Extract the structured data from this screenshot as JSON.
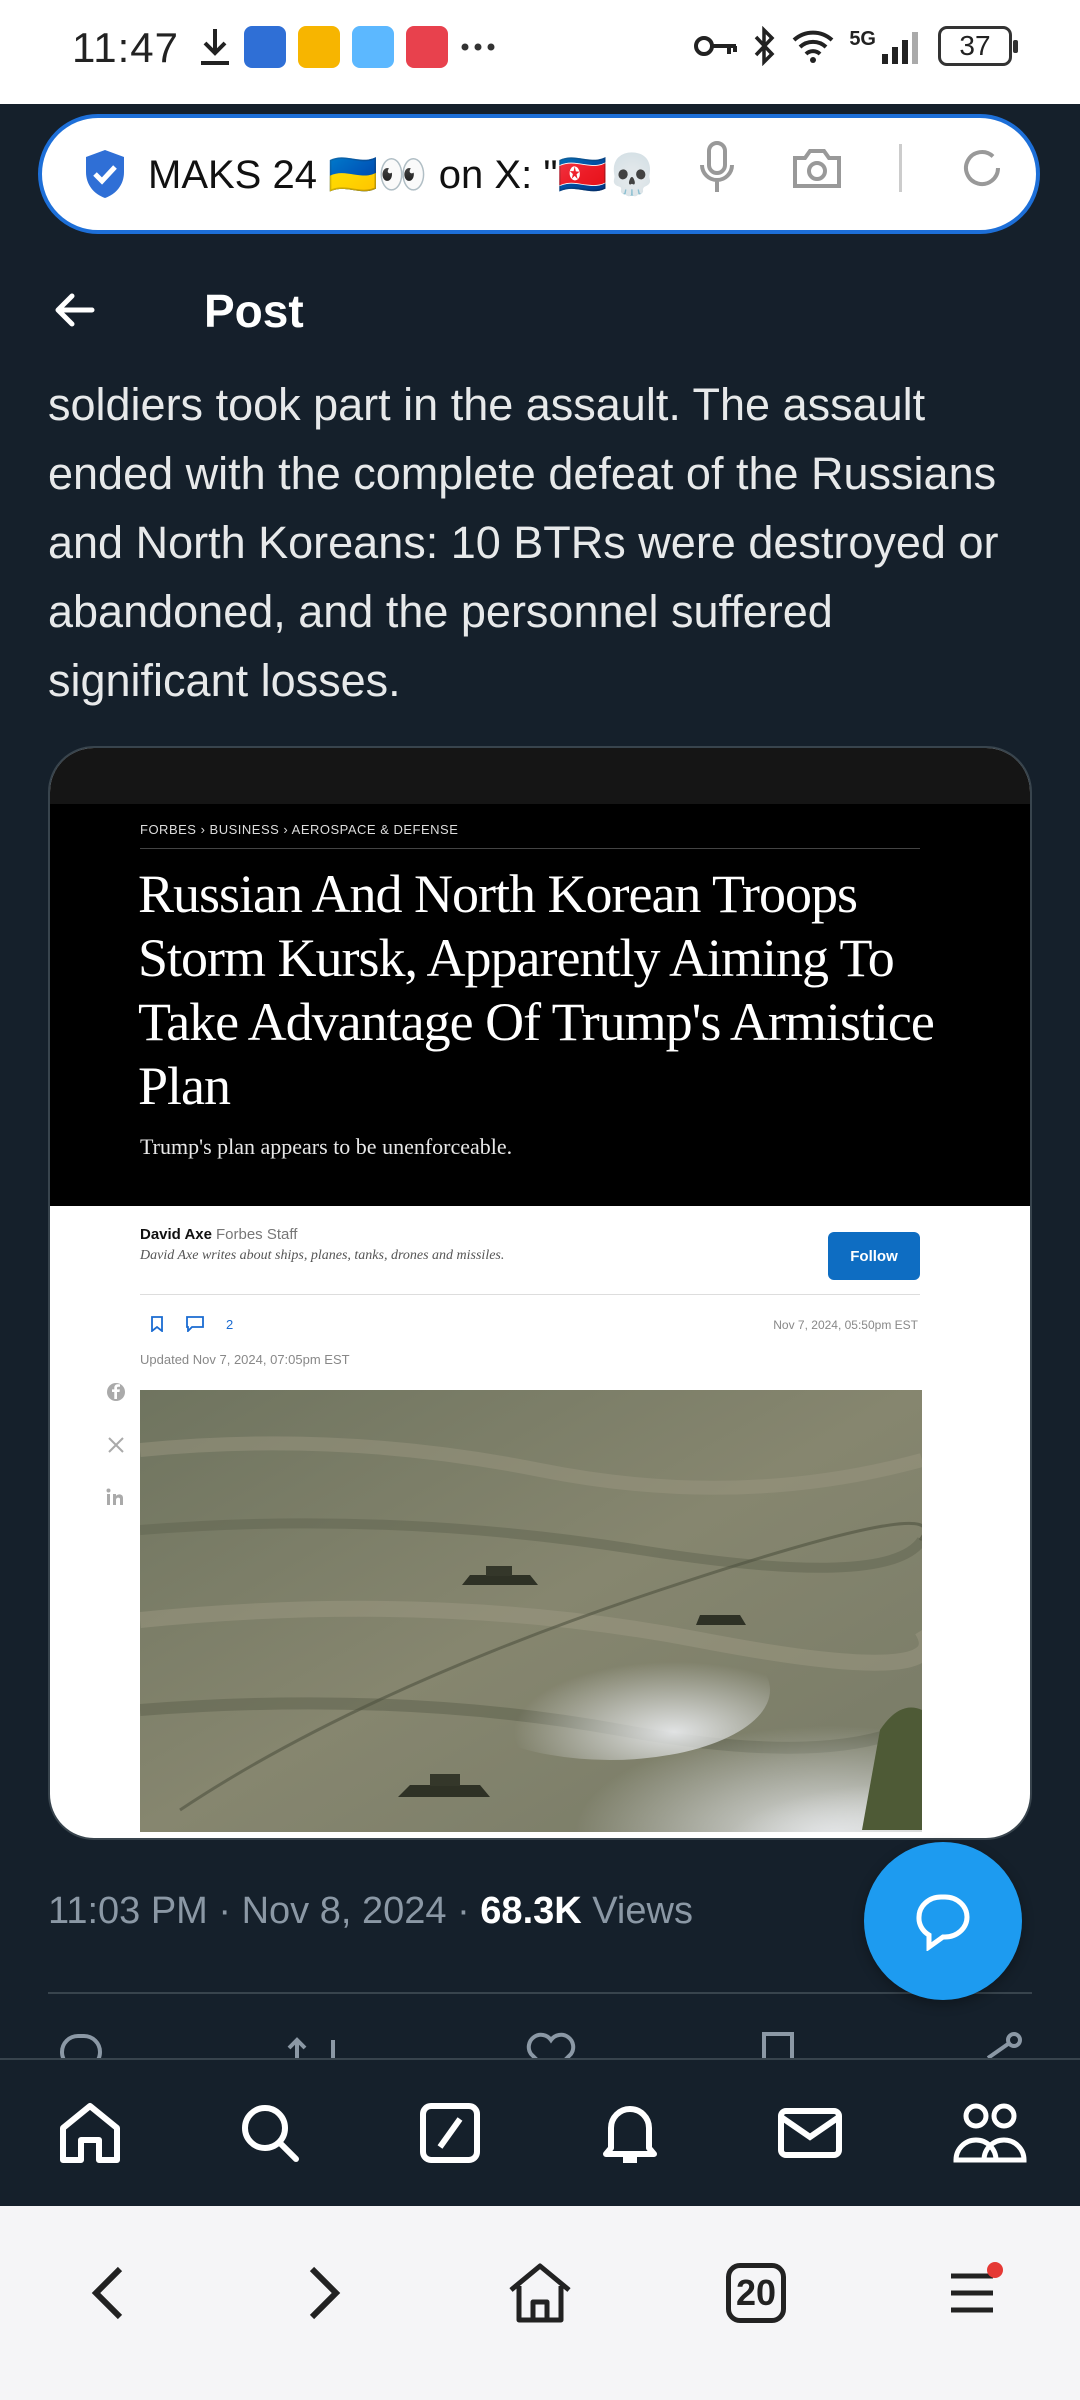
{
  "status_bar": {
    "time": "11:47",
    "network": "5G",
    "battery": "37"
  },
  "browser": {
    "url_text": "MAKS 24 🇺🇦👀 on X: \"🇰🇵💀",
    "tabs_count": "20"
  },
  "header": {
    "title": "Post"
  },
  "tweet": {
    "text": "soldiers took part in the assault. The assault ended with the complete defeat of the Russians and North Koreans: 10 BTRs were destroyed or abandoned, and the personnel suffered significant losses.",
    "time": "11:03 PM · Nov 8, 2024 · ",
    "views_count": "68.3K",
    "views_label": " Views"
  },
  "article": {
    "breadcrumb_1": "FORBES",
    "breadcrumb_2": "BUSINESS",
    "breadcrumb_3": "AEROSPACE & DEFENSE",
    "title": "Russian And North Korean Troops Storm Kursk, Apparently Aiming To Take Advantage Of Trump's Armistice Plan",
    "subtitle": "Trump's plan appears to be unenforceable.",
    "author": "David Axe",
    "author_role": "Forbes Staff",
    "author_bio": "David Axe writes about ships, planes, tanks, drones and missiles.",
    "follow_label": "Follow",
    "comments": "2",
    "published": "Nov 7, 2024, 05:50pm EST",
    "updated": "Updated Nov 7, 2024, 07:05pm EST"
  },
  "colors": {
    "background": "#15202b",
    "accent": "#1d9bf0",
    "url_border": "#1d6fd8"
  },
  "icons": {
    "nav": [
      "home-icon",
      "search-icon",
      "grok-icon",
      "notifications-icon",
      "messages-icon",
      "communities-icon"
    ],
    "browser": [
      "back-icon",
      "forward-icon",
      "home-icon",
      "tabs-icon",
      "menu-icon"
    ]
  }
}
